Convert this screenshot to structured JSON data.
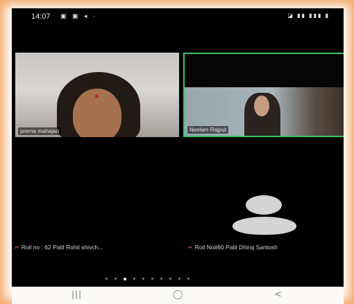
{
  "status_bar": {
    "time": "14:07",
    "left_icons": "▣ ▣ ◂ ·",
    "right_icons": "◪ ▮▮ ▮▮▮ ▮"
  },
  "participants": [
    {
      "name": "prerna mahajan",
      "video": true,
      "active_speaker": false
    },
    {
      "name": "Neelam Rajput",
      "video": true,
      "active_speaker": true
    },
    {
      "name": "Roll no : 62 Patil Rohit shivch...",
      "video": false,
      "muted": true
    },
    {
      "name": "Roll No#60 Patil Dhiraj Santosh",
      "video": false,
      "muted": true
    }
  ],
  "icons": {
    "mic_muted": "✂",
    "recents": "|||",
    "home": "◯",
    "back": "<"
  },
  "pager": {
    "count": 10,
    "active_index": 2
  },
  "colors": {
    "active_speaker_border": "#3bc46a",
    "muted_mic": "#ff6a4d",
    "frame_glow": "#f4a86a",
    "avatar": "#d4d4d4"
  }
}
